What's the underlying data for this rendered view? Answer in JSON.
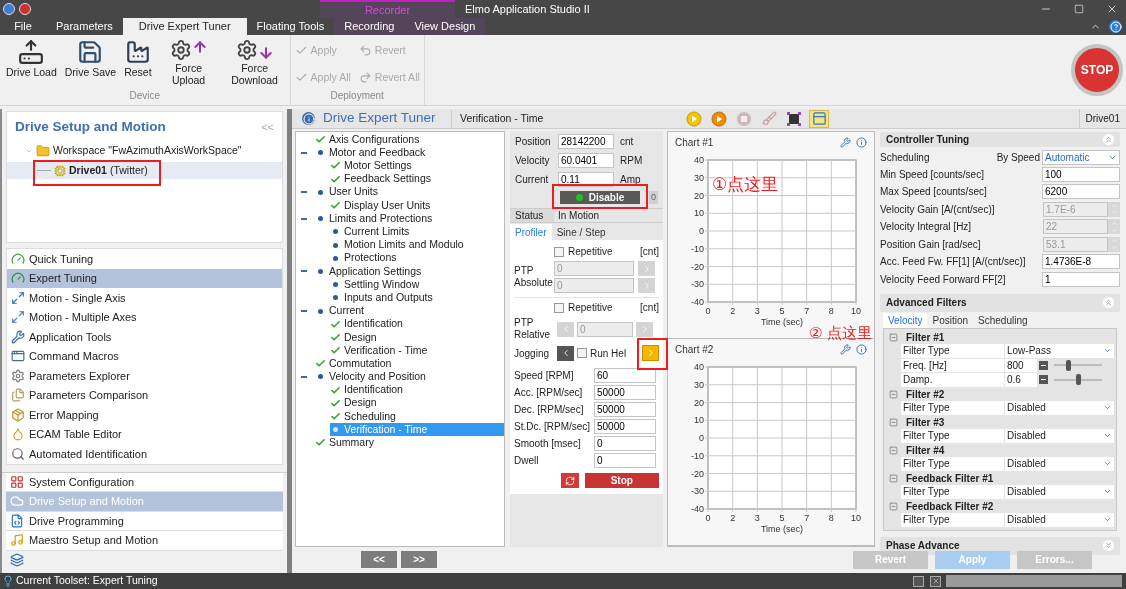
{
  "window": {
    "title": "Elmo Application Studio II",
    "context_group": "Recorder"
  },
  "ribbon_tabs": [
    {
      "label": "File",
      "selected": false,
      "contextual": false
    },
    {
      "label": "Parameters",
      "selected": false,
      "contextual": false
    },
    {
      "label": "Drive Expert Tuner",
      "selected": true,
      "contextual": false
    },
    {
      "label": "Floating Tools",
      "selected": false,
      "contextual": false
    },
    {
      "label": "Recording",
      "selected": false,
      "contextual": true
    },
    {
      "label": "View Design",
      "selected": false,
      "contextual": true
    }
  ],
  "ribbon": {
    "groups": [
      {
        "label": "Device",
        "kind": "large",
        "buttons": [
          {
            "label": "Drive Load",
            "disabled": false
          },
          {
            "label": "Drive Save",
            "disabled": false
          },
          {
            "label": "Reset",
            "disabled": false
          },
          {
            "label": "Force Upload",
            "disabled": false
          },
          {
            "label": "Force Download",
            "disabled": false
          }
        ]
      },
      {
        "label": "Deployment",
        "kind": "small",
        "buttons": [
          {
            "label": "Apply",
            "disabled": true
          },
          {
            "label": "Apply All",
            "disabled": true
          },
          {
            "label": "Revert",
            "disabled": true
          },
          {
            "label": "Revert All",
            "disabled": true
          }
        ]
      }
    ],
    "stop_button": "STOP"
  },
  "left_panel": {
    "title": "Drive Setup and Motion",
    "collapse": "<<",
    "tree": [
      {
        "label": "Workspace \"FwAzimuthAxisWorkSpace\"",
        "selected": false,
        "expanded": true,
        "children": [
          {
            "label": "Drive01",
            "note": "(Twitter)",
            "selected": true,
            "highlighted": true
          }
        ]
      }
    ]
  },
  "tools": [
    {
      "label": "Quick Tuning",
      "selected": false
    },
    {
      "label": "Expert Tuning",
      "selected": true
    },
    {
      "label": "Motion - Single Axis",
      "selected": false
    },
    {
      "label": "Motion - Multiple Axes",
      "selected": false
    },
    {
      "label": "Application Tools",
      "selected": false
    },
    {
      "label": "Command Macros",
      "selected": false
    },
    {
      "label": "Parameters Explorer",
      "selected": false
    },
    {
      "label": "Parameters Comparison",
      "selected": false
    },
    {
      "label": "Error Mapping",
      "selected": false
    },
    {
      "label": "ECAM Table Editor",
      "selected": false
    },
    {
      "label": "Automated Identification",
      "selected": false
    }
  ],
  "toolsets": [
    {
      "label": "System Configuration",
      "selected": false
    },
    {
      "label": "Drive Setup and Motion",
      "selected": true
    },
    {
      "label": "Drive Programming",
      "selected": false
    },
    {
      "label": "Maestro Setup and Motion",
      "selected": false
    }
  ],
  "tuner": {
    "title": "Drive Expert Tuner",
    "breadcrumb": "Verification - Time",
    "drive": "Drive01",
    "toolbar": [
      {
        "kind": "start",
        "disabled": false,
        "selected": false
      },
      {
        "kind": "run",
        "disabled": false,
        "selected": false
      },
      {
        "kind": "stop",
        "disabled": true,
        "selected": false
      },
      {
        "kind": "clear",
        "disabled": true,
        "selected": false
      },
      {
        "kind": "fit",
        "disabled": false,
        "selected": false
      },
      {
        "kind": "layout",
        "disabled": false,
        "selected": true
      }
    ],
    "steps": [
      {
        "label": "Axis Configurations",
        "done": true,
        "selected": false
      },
      {
        "label": "Motor and Feedback",
        "done": false,
        "selected": false,
        "expanded": true,
        "children": [
          {
            "label": "Motor Settings",
            "done": true,
            "selected": false
          },
          {
            "label": "Feedback Settings",
            "done": true,
            "selected": false
          }
        ]
      },
      {
        "label": "User Units",
        "done": false,
        "selected": false,
        "expanded": true,
        "children": [
          {
            "label": "Display User Units",
            "done": true,
            "selected": false
          }
        ]
      },
      {
        "label": "Limits and Protections",
        "done": false,
        "selected": false,
        "expanded": true,
        "children": [
          {
            "label": "Current Limits",
            "done": false,
            "selected": false
          },
          {
            "label": "Motion Limits and Modulo",
            "done": false,
            "selected": false
          },
          {
            "label": "Protections",
            "done": false,
            "selected": false
          }
        ]
      },
      {
        "label": "Application Settings",
        "done": false,
        "selected": false,
        "expanded": true,
        "children": [
          {
            "label": "Settling Window",
            "done": false,
            "selected": false
          },
          {
            "label": "Inputs and Outputs",
            "done": false,
            "selected": false
          }
        ]
      },
      {
        "label": "Current",
        "done": false,
        "selected": false,
        "expanded": true,
        "children": [
          {
            "label": "Identification",
            "done": true,
            "selected": false
          },
          {
            "label": "Design",
            "done": true,
            "selected": false
          },
          {
            "label": "Verification - Time",
            "done": true,
            "selected": false
          }
        ]
      },
      {
        "label": "Commutation",
        "done": true,
        "selected": false
      },
      {
        "label": "Velocity and Position",
        "done": false,
        "selected": false,
        "expanded": true,
        "children": [
          {
            "label": "Identification",
            "done": true,
            "selected": false
          },
          {
            "label": "Design",
            "done": true,
            "selected": false
          },
          {
            "label": "Scheduling",
            "done": true,
            "selected": false
          },
          {
            "label": "Verification - Time",
            "done": false,
            "selected": true
          }
        ]
      },
      {
        "label": "Summary",
        "done": true,
        "selected": false
      }
    ],
    "motion": {
      "readouts": [
        {
          "label": "Position",
          "value": "28142200",
          "unit": "cnt"
        },
        {
          "label": "Velocity",
          "value": "60.0401",
          "unit": "RPM"
        },
        {
          "label": "Current",
          "value": "0.11",
          "unit": "Amp"
        }
      ],
      "enable_button": {
        "label": "Disable",
        "on": true,
        "highlighted": true
      },
      "counter": "0",
      "status": {
        "label": "Status",
        "value": "In Motion"
      },
      "tabs": [
        {
          "label": "Profiler",
          "selected": true
        },
        {
          "label": "Sine / Step",
          "selected": false
        }
      ],
      "ptp_absolute": {
        "label": "PTP Absolute",
        "repetitive": {
          "label": "Repetitive",
          "checked": false
        },
        "unit": "[cnt]",
        "targets": [
          "0",
          "0"
        ]
      },
      "ptp_relative": {
        "label": "PTP Relative",
        "repetitive": {
          "label": "Repetitive",
          "checked": false
        },
        "unit": "[cnt]",
        "value": "0"
      },
      "jogging": {
        "label": "Jogging",
        "run_held": {
          "label": "Run Hel",
          "checked": false
        },
        "forward_highlighted": true
      },
      "params": [
        {
          "label": "Speed [RPM]",
          "value": "60"
        },
        {
          "label": "Acc. [RPM/sec]",
          "value": "50000"
        },
        {
          "label": "Dec. [RPM/sec]",
          "value": "50000"
        },
        {
          "label": "St.Dc. [RPM/sec]",
          "value": "50000"
        },
        {
          "label": "Smooth [msec]",
          "value": "0"
        },
        {
          "label": "Dwell",
          "value": "0"
        }
      ],
      "stop_button": "Stop"
    },
    "charts": [
      {
        "chart_data": {
          "type": "line",
          "title": "Chart #1",
          "xlabel": "Time (sec)",
          "grid": true,
          "xlim": [
            0,
            10
          ],
          "ylim": [
            -40,
            40
          ],
          "xticks": [
            {
              "value": 0,
              "label": "0"
            },
            {
              "value": 1.667,
              "label": "2"
            },
            {
              "value": 3.333,
              "label": "3"
            },
            {
              "value": 5,
              "label": "5"
            },
            {
              "value": 6.667,
              "label": "7"
            },
            {
              "value": 8.333,
              "label": "8"
            },
            {
              "value": 10,
              "label": "10"
            }
          ],
          "yticks": [
            -40,
            -30,
            -20,
            -10,
            0,
            10,
            20,
            30,
            40
          ]
        }
      },
      {
        "chart_data": {
          "type": "line",
          "title": "Chart #2",
          "xlabel": "Time (sec)",
          "grid": true,
          "xlim": [
            0,
            10
          ],
          "ylim": [
            -40,
            40
          ],
          "xticks": [
            {
              "value": 0,
              "label": "0"
            },
            {
              "value": 1.667,
              "label": "2"
            },
            {
              "value": 3.333,
              "label": "3"
            },
            {
              "value": 5,
              "label": "5"
            },
            {
              "value": 6.667,
              "label": "7"
            },
            {
              "value": 8.333,
              "label": "8"
            },
            {
              "value": 10,
              "label": "10"
            }
          ],
          "yticks": [
            -40,
            -30,
            -20,
            -10,
            0,
            10,
            20,
            30,
            40
          ]
        }
      }
    ],
    "controller_tuning": {
      "title": "Controller Tuning",
      "expanded": true,
      "scheduling": {
        "label": "Scheduling",
        "mode_label": "By Speed",
        "value": "Automatic"
      },
      "rows": [
        {
          "label": "Min Speed [counts/sec]",
          "value": "100",
          "kind": "text",
          "disabled": false
        },
        {
          "label": "Max Speed [counts/sec]",
          "value": "6200",
          "kind": "text",
          "disabled": false
        },
        {
          "label": "Velocity Gain [A/(cnt/sec)]",
          "value": "1.7E-6",
          "kind": "spin",
          "disabled": true
        },
        {
          "label": "Velocity Integral [Hz]",
          "value": "22",
          "kind": "spin",
          "disabled": true
        },
        {
          "label": "Position Gain [rad/sec]",
          "value": "53.1",
          "kind": "spin",
          "disabled": true
        },
        {
          "label": "Acc. Feed Fw. FF[1] [A/(cnt/sec)]",
          "value": "1.4736E-8",
          "kind": "text",
          "disabled": false
        },
        {
          "label": "Velocity Feed Forward FF[2]",
          "value": "1",
          "kind": "text",
          "disabled": false
        }
      ]
    },
    "advanced_filters": {
      "title": "Advanced Filters",
      "expanded": true,
      "tabs": [
        {
          "label": "Velocity",
          "selected": true
        },
        {
          "label": "Position",
          "selected": false
        },
        {
          "label": "Scheduling",
          "selected": false
        }
      ],
      "filters": [
        {
          "title": "Filter #1",
          "expanded": true,
          "rows": [
            {
              "kind": "select",
              "label": "Filter Type",
              "value": "Low-Pass"
            },
            {
              "kind": "slider",
              "label": "Freq. [Hz]",
              "value": "800",
              "level": 0.3
            },
            {
              "kind": "slider",
              "label": "Damp.",
              "value": "0.6",
              "level": 0.5
            }
          ]
        },
        {
          "title": "Filter #2",
          "expanded": true,
          "rows": [
            {
              "kind": "select",
              "label": "Filter Type",
              "value": "Disabled"
            }
          ]
        },
        {
          "title": "Filter #3",
          "expanded": true,
          "rows": [
            {
              "kind": "select",
              "label": "Filter Type",
              "value": "Disabled"
            }
          ]
        },
        {
          "title": "Filter #4",
          "expanded": true,
          "rows": [
            {
              "kind": "select",
              "label": "Filter Type",
              "value": "Disabled"
            }
          ]
        },
        {
          "title": "Feedback Filter #1",
          "expanded": true,
          "rows": [
            {
              "kind": "select",
              "label": "Filter Type",
              "value": "Disabled"
            }
          ]
        },
        {
          "title": "Feedback Filter #2",
          "expanded": true,
          "rows": [
            {
              "kind": "select",
              "label": "Filter Type",
              "value": "Disabled"
            }
          ]
        }
      ]
    },
    "phase_advance": {
      "title": "Phase Advance",
      "expanded": false
    },
    "nav_buttons": [
      "<<",
      ">>"
    ],
    "footer_buttons": [
      {
        "label": "Revert",
        "kind": "default",
        "disabled": true
      },
      {
        "label": "Apply",
        "kind": "primary",
        "disabled": true
      },
      {
        "label": "Errors...",
        "kind": "default",
        "disabled": true
      }
    ]
  },
  "status_bar": {
    "text": "Current Toolset: Expert Tuning"
  },
  "annotations": [
    {
      "text": "①点这里"
    },
    {
      "text": "② 点这里"
    }
  ]
}
